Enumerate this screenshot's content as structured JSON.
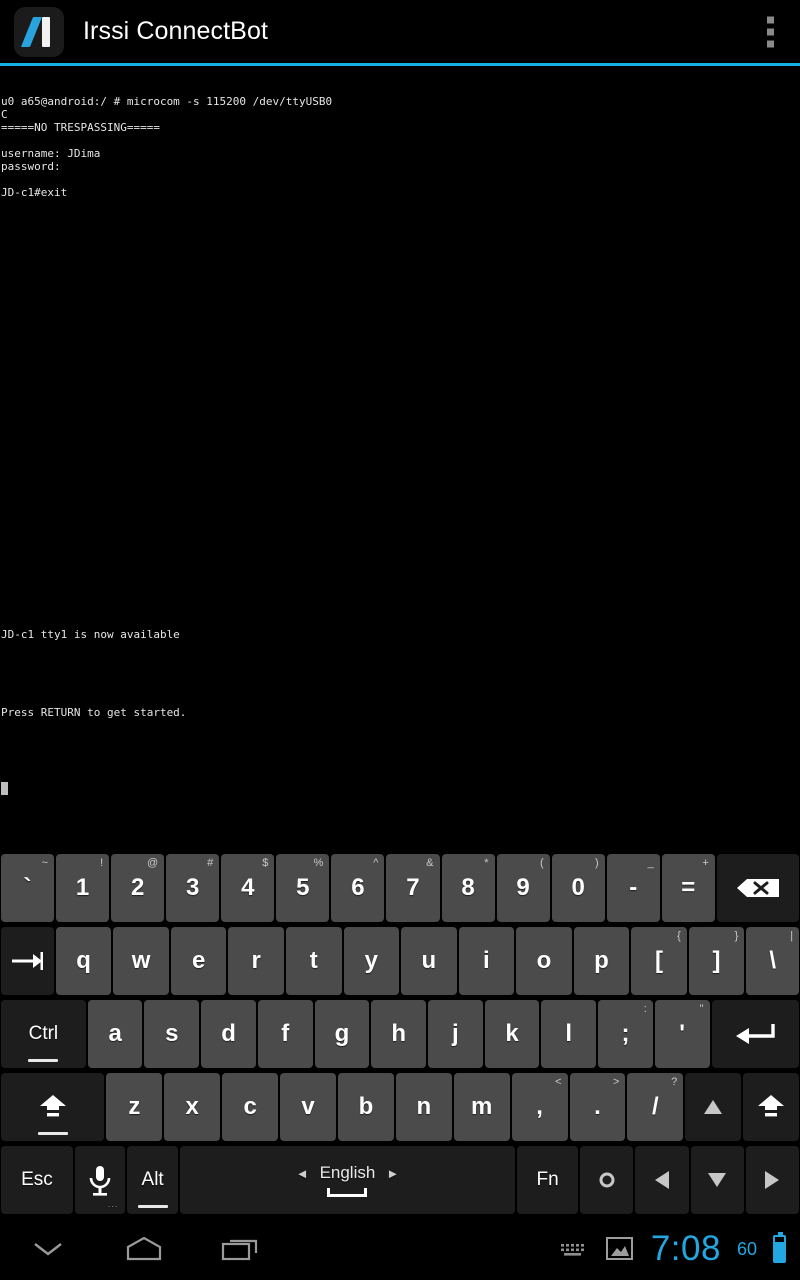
{
  "titlebar": {
    "app_title": "Irssi ConnectBot",
    "logo_name": "irssi-connectbot-logo",
    "overflow_label": "More options"
  },
  "terminal": {
    "lines": [
      "u0 a65@android:/ # microcom -s 115200 /dev/ttyUSB0",
      "C",
      "=====NO TRESPASSING=====",
      "",
      "username: JDima",
      "password:",
      "",
      "JD-c1#exit",
      "",
      "",
      "",
      "",
      "",
      "",
      "",
      "",
      "",
      "",
      "",
      "",
      "",
      "",
      "",
      "",
      "",
      "",
      "",
      "",
      "",
      "",
      "",
      "",
      "",
      "",
      "",
      "",
      "",
      "",
      "",
      "",
      "",
      "JD-c1 tty1 is now available",
      "",
      "",
      "",
      "",
      "",
      "Press RETURN to get started."
    ]
  },
  "keyboard": {
    "rows": [
      {
        "name": "number-row",
        "keys": [
          {
            "name": "key-backtick",
            "label": "`",
            "sup": "~",
            "dark": false,
            "width": ""
          },
          {
            "name": "key-1",
            "label": "1",
            "sup": "!",
            "dark": false,
            "width": ""
          },
          {
            "name": "key-2",
            "label": "2",
            "sup": "@",
            "dark": false,
            "width": ""
          },
          {
            "name": "key-3",
            "label": "3",
            "sup": "#",
            "dark": false,
            "width": ""
          },
          {
            "name": "key-4",
            "label": "4",
            "sup": "$",
            "dark": false,
            "width": ""
          },
          {
            "name": "key-5",
            "label": "5",
            "sup": "%",
            "dark": false,
            "width": ""
          },
          {
            "name": "key-6",
            "label": "6",
            "sup": "^",
            "dark": false,
            "width": ""
          },
          {
            "name": "key-7",
            "label": "7",
            "sup": "&",
            "dark": false,
            "width": ""
          },
          {
            "name": "key-8",
            "label": "8",
            "sup": "*",
            "dark": false,
            "width": ""
          },
          {
            "name": "key-9",
            "label": "9",
            "sup": "(",
            "dark": false,
            "width": ""
          },
          {
            "name": "key-0",
            "label": "0",
            "sup": ")",
            "dark": false,
            "width": ""
          },
          {
            "name": "key-minus",
            "label": "-",
            "sup": "_",
            "dark": false,
            "width": ""
          },
          {
            "name": "key-equals",
            "label": "=",
            "sup": "+",
            "dark": false,
            "width": ""
          },
          {
            "name": "key-backspace",
            "label": "",
            "icon": "backspace-icon",
            "sup": "",
            "dark": true,
            "width": "w-back"
          }
        ]
      },
      {
        "name": "qwerty-row",
        "keys": [
          {
            "name": "key-tab",
            "label": "",
            "icon": "tab-icon",
            "sup": "",
            "dark": true,
            "width": "w-tab"
          },
          {
            "name": "key-q",
            "label": "q",
            "sup": "",
            "dark": false,
            "width": ""
          },
          {
            "name": "key-w",
            "label": "w",
            "sup": "",
            "dark": false,
            "width": ""
          },
          {
            "name": "key-e",
            "label": "e",
            "sup": "",
            "dark": false,
            "width": ""
          },
          {
            "name": "key-r",
            "label": "r",
            "sup": "",
            "dark": false,
            "width": ""
          },
          {
            "name": "key-t",
            "label": "t",
            "sup": "",
            "dark": false,
            "width": ""
          },
          {
            "name": "key-y",
            "label": "y",
            "sup": "",
            "dark": false,
            "width": ""
          },
          {
            "name": "key-u",
            "label": "u",
            "sup": "",
            "dark": false,
            "width": ""
          },
          {
            "name": "key-i",
            "label": "i",
            "sup": "",
            "dark": false,
            "width": ""
          },
          {
            "name": "key-o",
            "label": "o",
            "sup": "",
            "dark": false,
            "width": ""
          },
          {
            "name": "key-p",
            "label": "p",
            "sup": "",
            "dark": false,
            "width": ""
          },
          {
            "name": "key-bracket-left",
            "label": "[",
            "sup": "{",
            "dark": false,
            "width": ""
          },
          {
            "name": "key-bracket-right",
            "label": "]",
            "sup": "}",
            "dark": false,
            "width": ""
          },
          {
            "name": "key-backslash",
            "label": "\\",
            "sup": "|",
            "dark": false,
            "width": "w-bsl"
          }
        ]
      },
      {
        "name": "home-row",
        "keys": [
          {
            "name": "key-ctrl",
            "label": "Ctrl",
            "sup": "",
            "dark": true,
            "width": "w-ctrl",
            "lbl": true,
            "under": true
          },
          {
            "name": "key-a",
            "label": "a",
            "sup": "",
            "dark": false,
            "width": ""
          },
          {
            "name": "key-s",
            "label": "s",
            "sup": "",
            "dark": false,
            "width": ""
          },
          {
            "name": "key-d",
            "label": "d",
            "sup": "",
            "dark": false,
            "width": ""
          },
          {
            "name": "key-f",
            "label": "f",
            "sup": "",
            "dark": false,
            "width": ""
          },
          {
            "name": "key-g",
            "label": "g",
            "sup": "",
            "dark": false,
            "width": ""
          },
          {
            "name": "key-h",
            "label": "h",
            "sup": "",
            "dark": false,
            "width": ""
          },
          {
            "name": "key-j",
            "label": "j",
            "sup": "",
            "dark": false,
            "width": ""
          },
          {
            "name": "key-k",
            "label": "k",
            "sup": "",
            "dark": false,
            "width": ""
          },
          {
            "name": "key-l",
            "label": "l",
            "sup": "",
            "dark": false,
            "width": ""
          },
          {
            "name": "key-semicolon",
            "label": ";",
            "sup": ":",
            "dark": false,
            "width": ""
          },
          {
            "name": "key-apostrophe",
            "label": "'",
            "sup": "\"",
            "dark": false,
            "width": ""
          },
          {
            "name": "key-enter",
            "label": "",
            "icon": "enter-icon",
            "sup": "",
            "dark": true,
            "width": "w-ent"
          }
        ]
      },
      {
        "name": "shift-row",
        "keys": [
          {
            "name": "key-shift-left",
            "label": "",
            "icon": "shift-icon",
            "sup": "",
            "dark": true,
            "width": "w-shl",
            "under": true
          },
          {
            "name": "key-z",
            "label": "z",
            "sup": "",
            "dark": false,
            "width": ""
          },
          {
            "name": "key-x",
            "label": "x",
            "sup": "",
            "dark": false,
            "width": ""
          },
          {
            "name": "key-c",
            "label": "c",
            "sup": "",
            "dark": false,
            "width": ""
          },
          {
            "name": "key-v",
            "label": "v",
            "sup": "",
            "dark": false,
            "width": ""
          },
          {
            "name": "key-b",
            "label": "b",
            "sup": "",
            "dark": false,
            "width": ""
          },
          {
            "name": "key-n",
            "label": "n",
            "sup": "",
            "dark": false,
            "width": ""
          },
          {
            "name": "key-m",
            "label": "m",
            "sup": "",
            "dark": false,
            "width": ""
          },
          {
            "name": "key-comma",
            "label": ",",
            "sup": "<",
            "dark": false,
            "width": ""
          },
          {
            "name": "key-period",
            "label": ".",
            "sup": ">",
            "dark": false,
            "width": ""
          },
          {
            "name": "key-slash",
            "label": "/",
            "sup": "?",
            "dark": false,
            "width": ""
          },
          {
            "name": "key-arrow-up",
            "label": "",
            "icon": "arrow-up-icon",
            "sup": "",
            "dark": true,
            "width": "w-arr"
          },
          {
            "name": "key-shift-right",
            "label": "",
            "icon": "shift-icon",
            "sup": "",
            "dark": true,
            "width": "w-shr"
          }
        ]
      },
      {
        "name": "bottom-row",
        "keys": [
          {
            "name": "key-esc",
            "label": "Esc",
            "sup": "",
            "dark": true,
            "width": "w-esc",
            "lbl": true
          },
          {
            "name": "key-microphone",
            "label": "",
            "icon": "microphone-icon",
            "sup": "",
            "dark": true,
            "width": "w-mic",
            "dots": "..."
          },
          {
            "name": "key-alt",
            "label": "Alt",
            "sup": "",
            "dark": true,
            "width": "w-alt",
            "lbl": true,
            "under": true
          },
          {
            "name": "key-space",
            "label": "",
            "icon": "space-icon",
            "sup": "",
            "dark": true,
            "width": "w-space"
          },
          {
            "name": "key-fn",
            "label": "Fn",
            "sup": "",
            "dark": true,
            "width": "w-fn",
            "lbl": true
          },
          {
            "name": "key-settings",
            "label": "",
            "icon": "circle-icon",
            "sup": "",
            "dark": true,
            "width": "w-arr"
          },
          {
            "name": "key-arrow-left",
            "label": "",
            "icon": "arrow-left-icon",
            "sup": "",
            "dark": true,
            "width": "w-arr"
          },
          {
            "name": "key-arrow-down",
            "label": "",
            "icon": "arrow-down-icon",
            "sup": "",
            "dark": true,
            "width": "w-arr"
          },
          {
            "name": "key-arrow-right",
            "label": "",
            "icon": "arrow-right-icon",
            "sup": "",
            "dark": true,
            "width": "w-arr"
          }
        ]
      }
    ],
    "space_language": "English"
  },
  "navbar": {
    "back_label": "Hide keyboard",
    "home_label": "Home",
    "recents_label": "Recent apps",
    "keyboard_indicator": "keyboard-icon",
    "image_indicator": "image-icon",
    "clock": "7:08",
    "battery_level": "60"
  },
  "colors": {
    "accent": "#15aee5",
    "status_blue": "#22a7e0",
    "key_light": "#4b4b4b",
    "key_dark": "#1d1d1d",
    "terminal_fg": "#e6e6e6",
    "background": "#000000"
  }
}
